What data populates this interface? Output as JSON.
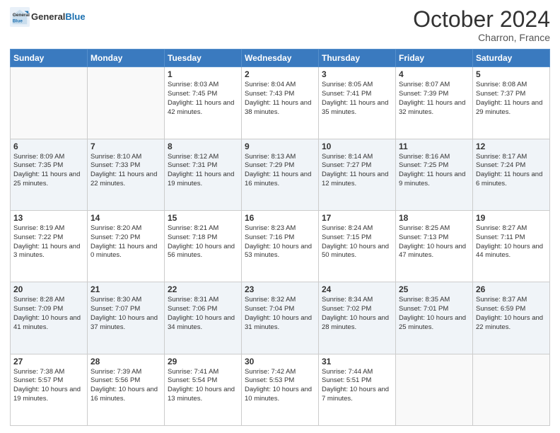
{
  "logo": {
    "text_general": "General",
    "text_blue": "Blue"
  },
  "header": {
    "month": "October 2024",
    "location": "Charron, France"
  },
  "weekdays": [
    "Sunday",
    "Monday",
    "Tuesday",
    "Wednesday",
    "Thursday",
    "Friday",
    "Saturday"
  ],
  "weeks": [
    [
      {
        "day": "",
        "empty": true
      },
      {
        "day": "",
        "empty": true
      },
      {
        "day": "1",
        "sunrise": "Sunrise: 8:03 AM",
        "sunset": "Sunset: 7:45 PM",
        "daylight": "Daylight: 11 hours and 42 minutes."
      },
      {
        "day": "2",
        "sunrise": "Sunrise: 8:04 AM",
        "sunset": "Sunset: 7:43 PM",
        "daylight": "Daylight: 11 hours and 38 minutes."
      },
      {
        "day": "3",
        "sunrise": "Sunrise: 8:05 AM",
        "sunset": "Sunset: 7:41 PM",
        "daylight": "Daylight: 11 hours and 35 minutes."
      },
      {
        "day": "4",
        "sunrise": "Sunrise: 8:07 AM",
        "sunset": "Sunset: 7:39 PM",
        "daylight": "Daylight: 11 hours and 32 minutes."
      },
      {
        "day": "5",
        "sunrise": "Sunrise: 8:08 AM",
        "sunset": "Sunset: 7:37 PM",
        "daylight": "Daylight: 11 hours and 29 minutes."
      }
    ],
    [
      {
        "day": "6",
        "sunrise": "Sunrise: 8:09 AM",
        "sunset": "Sunset: 7:35 PM",
        "daylight": "Daylight: 11 hours and 25 minutes."
      },
      {
        "day": "7",
        "sunrise": "Sunrise: 8:10 AM",
        "sunset": "Sunset: 7:33 PM",
        "daylight": "Daylight: 11 hours and 22 minutes."
      },
      {
        "day": "8",
        "sunrise": "Sunrise: 8:12 AM",
        "sunset": "Sunset: 7:31 PM",
        "daylight": "Daylight: 11 hours and 19 minutes."
      },
      {
        "day": "9",
        "sunrise": "Sunrise: 8:13 AM",
        "sunset": "Sunset: 7:29 PM",
        "daylight": "Daylight: 11 hours and 16 minutes."
      },
      {
        "day": "10",
        "sunrise": "Sunrise: 8:14 AM",
        "sunset": "Sunset: 7:27 PM",
        "daylight": "Daylight: 11 hours and 12 minutes."
      },
      {
        "day": "11",
        "sunrise": "Sunrise: 8:16 AM",
        "sunset": "Sunset: 7:25 PM",
        "daylight": "Daylight: 11 hours and 9 minutes."
      },
      {
        "day": "12",
        "sunrise": "Sunrise: 8:17 AM",
        "sunset": "Sunset: 7:24 PM",
        "daylight": "Daylight: 11 hours and 6 minutes."
      }
    ],
    [
      {
        "day": "13",
        "sunrise": "Sunrise: 8:19 AM",
        "sunset": "Sunset: 7:22 PM",
        "daylight": "Daylight: 11 hours and 3 minutes."
      },
      {
        "day": "14",
        "sunrise": "Sunrise: 8:20 AM",
        "sunset": "Sunset: 7:20 PM",
        "daylight": "Daylight: 11 hours and 0 minutes."
      },
      {
        "day": "15",
        "sunrise": "Sunrise: 8:21 AM",
        "sunset": "Sunset: 7:18 PM",
        "daylight": "Daylight: 10 hours and 56 minutes."
      },
      {
        "day": "16",
        "sunrise": "Sunrise: 8:23 AM",
        "sunset": "Sunset: 7:16 PM",
        "daylight": "Daylight: 10 hours and 53 minutes."
      },
      {
        "day": "17",
        "sunrise": "Sunrise: 8:24 AM",
        "sunset": "Sunset: 7:15 PM",
        "daylight": "Daylight: 10 hours and 50 minutes."
      },
      {
        "day": "18",
        "sunrise": "Sunrise: 8:25 AM",
        "sunset": "Sunset: 7:13 PM",
        "daylight": "Daylight: 10 hours and 47 minutes."
      },
      {
        "day": "19",
        "sunrise": "Sunrise: 8:27 AM",
        "sunset": "Sunset: 7:11 PM",
        "daylight": "Daylight: 10 hours and 44 minutes."
      }
    ],
    [
      {
        "day": "20",
        "sunrise": "Sunrise: 8:28 AM",
        "sunset": "Sunset: 7:09 PM",
        "daylight": "Daylight: 10 hours and 41 minutes."
      },
      {
        "day": "21",
        "sunrise": "Sunrise: 8:30 AM",
        "sunset": "Sunset: 7:07 PM",
        "daylight": "Daylight: 10 hours and 37 minutes."
      },
      {
        "day": "22",
        "sunrise": "Sunrise: 8:31 AM",
        "sunset": "Sunset: 7:06 PM",
        "daylight": "Daylight: 10 hours and 34 minutes."
      },
      {
        "day": "23",
        "sunrise": "Sunrise: 8:32 AM",
        "sunset": "Sunset: 7:04 PM",
        "daylight": "Daylight: 10 hours and 31 minutes."
      },
      {
        "day": "24",
        "sunrise": "Sunrise: 8:34 AM",
        "sunset": "Sunset: 7:02 PM",
        "daylight": "Daylight: 10 hours and 28 minutes."
      },
      {
        "day": "25",
        "sunrise": "Sunrise: 8:35 AM",
        "sunset": "Sunset: 7:01 PM",
        "daylight": "Daylight: 10 hours and 25 minutes."
      },
      {
        "day": "26",
        "sunrise": "Sunrise: 8:37 AM",
        "sunset": "Sunset: 6:59 PM",
        "daylight": "Daylight: 10 hours and 22 minutes."
      }
    ],
    [
      {
        "day": "27",
        "sunrise": "Sunrise: 7:38 AM",
        "sunset": "Sunset: 5:57 PM",
        "daylight": "Daylight: 10 hours and 19 minutes."
      },
      {
        "day": "28",
        "sunrise": "Sunrise: 7:39 AM",
        "sunset": "Sunset: 5:56 PM",
        "daylight": "Daylight: 10 hours and 16 minutes."
      },
      {
        "day": "29",
        "sunrise": "Sunrise: 7:41 AM",
        "sunset": "Sunset: 5:54 PM",
        "daylight": "Daylight: 10 hours and 13 minutes."
      },
      {
        "day": "30",
        "sunrise": "Sunrise: 7:42 AM",
        "sunset": "Sunset: 5:53 PM",
        "daylight": "Daylight: 10 hours and 10 minutes."
      },
      {
        "day": "31",
        "sunrise": "Sunrise: 7:44 AM",
        "sunset": "Sunset: 5:51 PM",
        "daylight": "Daylight: 10 hours and 7 minutes."
      },
      {
        "day": "",
        "empty": true
      },
      {
        "day": "",
        "empty": true
      }
    ]
  ]
}
